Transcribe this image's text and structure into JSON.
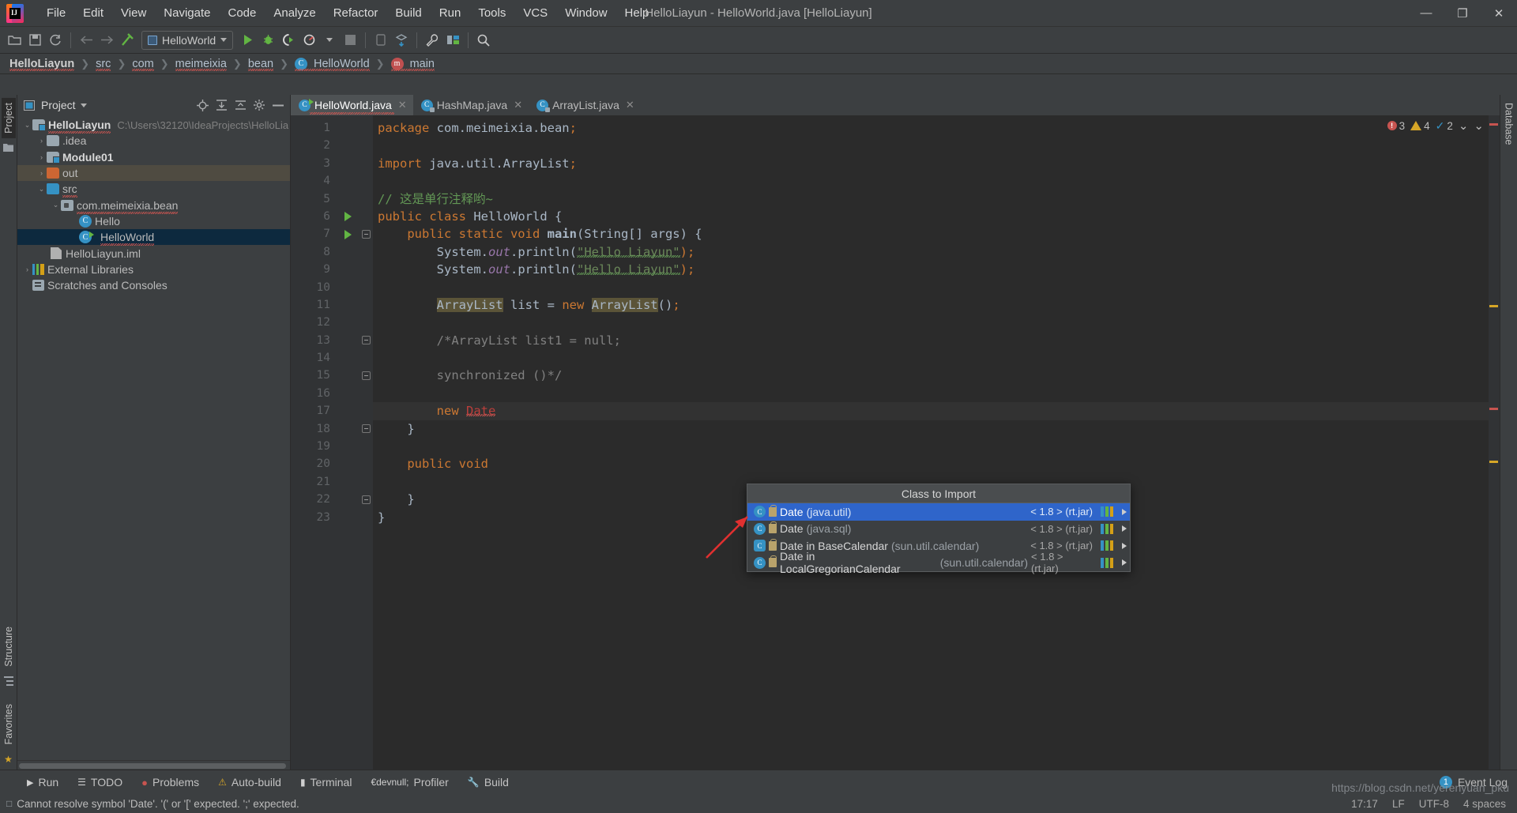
{
  "window": {
    "title": "HelloLiayun - HelloWorld.java [HelloLiayun]",
    "minimize": "—",
    "maximize": "❐",
    "close": "✕"
  },
  "menu": [
    {
      "label": "File"
    },
    {
      "label": "Edit"
    },
    {
      "label": "View"
    },
    {
      "label": "Navigate"
    },
    {
      "label": "Code"
    },
    {
      "label": "Analyze"
    },
    {
      "label": "Refactor"
    },
    {
      "label": "Build"
    },
    {
      "label": "Run"
    },
    {
      "label": "Tools"
    },
    {
      "label": "VCS"
    },
    {
      "label": "Window"
    },
    {
      "label": "Help"
    }
  ],
  "toolbar": {
    "run_config": "HelloWorld",
    "icons": [
      "open-folder-icon",
      "save-icon",
      "sync-icon",
      "back-arrow-icon",
      "forward-arrow-icon",
      "build-hammer-icon",
      "run-icon",
      "debug-icon",
      "run-coverage-icon",
      "profiler-icon",
      "stop-icon",
      "device-manager-icon",
      "sdk-manager-icon",
      "settings-wrench-icon",
      "project-structure-icon",
      "search-everywhere-icon"
    ]
  },
  "breadcrumb": [
    {
      "label": "HelloLiayun",
      "bold": true,
      "squiggle": true,
      "icon": ""
    },
    {
      "label": "src",
      "squiggle": true,
      "icon": ""
    },
    {
      "label": "com",
      "squiggle": true,
      "icon": ""
    },
    {
      "label": "meimeixia",
      "squiggle": true,
      "icon": ""
    },
    {
      "label": "bean",
      "squiggle": true,
      "icon": ""
    },
    {
      "label": "HelloWorld",
      "squiggle": true,
      "icon": "class-icon"
    },
    {
      "label": "main",
      "squiggle": true,
      "icon": "method-icon"
    }
  ],
  "left_rail": {
    "tabs": [
      "Project",
      "Structure",
      "Favorites"
    ],
    "icons": [
      "project-files-icon",
      "structure-icon",
      "favorites-star-icon"
    ]
  },
  "right_rail": {
    "tabs": [
      "Database"
    ]
  },
  "project_panel": {
    "title": "Project",
    "header_icons": [
      "locate-target-icon",
      "expand-all-icon",
      "collapse-all-icon",
      "gear-icon",
      "hide-icon"
    ],
    "tree": [
      {
        "depth": 0,
        "arrow": "⌄",
        "label": "HelloLiayun",
        "path": "C:\\Users\\32120\\IdeaProjects\\HelloLia",
        "icon": "folder-module",
        "bold": true,
        "squiggle": true
      },
      {
        "depth": 1,
        "arrow": "›",
        "label": ".idea",
        "icon": "folder-grey"
      },
      {
        "depth": 1,
        "arrow": "›",
        "label": "Module01",
        "icon": "folder-module",
        "bold": true
      },
      {
        "depth": 1,
        "arrow": "›",
        "label": "out",
        "icon": "folder-orange",
        "highlight": true
      },
      {
        "depth": 1,
        "arrow": "⌄",
        "label": "src",
        "icon": "folder-blue",
        "squiggle": true
      },
      {
        "depth": 2,
        "arrow": "⌄",
        "label": "com.meimeixia.bean",
        "icon": "package-icon",
        "squiggle": true
      },
      {
        "depth": 3,
        "arrow": "",
        "label": "Hello",
        "icon": "class-icon"
      },
      {
        "depth": 3,
        "arrow": "",
        "label": "HelloWorld",
        "icon": "class-run-icon",
        "selected": true,
        "squiggle": true
      },
      {
        "depth": 1,
        "arrow": "",
        "label": "HelloLiayun.iml",
        "icon": "iml-icon"
      },
      {
        "depth": 0,
        "arrow": "›",
        "label": "External Libraries",
        "icon": "library-icon"
      },
      {
        "depth": 0,
        "arrow": "",
        "label": "Scratches and Consoles",
        "icon": "scratches-icon"
      }
    ]
  },
  "editor_tabs": [
    {
      "label": "HelloWorld.java",
      "icon": "java-class-run-icon",
      "active": true,
      "close": "✕",
      "squiggle": true
    },
    {
      "label": "HashMap.java",
      "icon": "java-class-lock-icon",
      "active": false,
      "close": "✕"
    },
    {
      "label": "ArrayList.java",
      "icon": "java-class-lock-icon",
      "active": false,
      "close": "✕"
    }
  ],
  "code": {
    "lines": [
      {
        "n": "1",
        "text": "package com.meimeixia.bean;"
      },
      {
        "n": "2",
        "text": ""
      },
      {
        "n": "3",
        "text": "import java.util.ArrayList;"
      },
      {
        "n": "4",
        "text": ""
      },
      {
        "n": "5",
        "text": "// 这是单行注释哟~"
      },
      {
        "n": "6",
        "text": "public class HelloWorld {",
        "run": true
      },
      {
        "n": "7",
        "text": "    public static void main(String[] args) {",
        "run": true,
        "fold": "start"
      },
      {
        "n": "8",
        "text": "        System.out.println(\"Hello Liayun\");"
      },
      {
        "n": "9",
        "text": "        System.out.println(\"Hello Liayun\");"
      },
      {
        "n": "10",
        "text": ""
      },
      {
        "n": "11",
        "text": "        ArrayList list = new ArrayList();"
      },
      {
        "n": "12",
        "text": ""
      },
      {
        "n": "13",
        "text": "        /*ArrayList list1 = null;",
        "fold": "start"
      },
      {
        "n": "14",
        "text": ""
      },
      {
        "n": "15",
        "text": "        synchronized ()*/",
        "fold": "end"
      },
      {
        "n": "16",
        "text": ""
      },
      {
        "n": "17",
        "text": "        new Date",
        "current": true
      },
      {
        "n": "18",
        "text": "    }",
        "fold": "end"
      },
      {
        "n": "19",
        "text": ""
      },
      {
        "n": "20",
        "text": "    public void"
      },
      {
        "n": "21",
        "text": ""
      },
      {
        "n": "22",
        "text": "    }",
        "fold": "end"
      },
      {
        "n": "23",
        "text": "}"
      }
    ]
  },
  "inspections": {
    "errors": "3",
    "warnings": "4",
    "weak": "2",
    "chevron": "⌄",
    "more": "⌄"
  },
  "popup": {
    "title": "Class to Import",
    "rows": [
      {
        "name": "Date",
        "pkg": "(java.util)",
        "version": "< 1.8 > (rt.jar)",
        "icon": "class-icon",
        "selected": true,
        "arrow": "▶"
      },
      {
        "name": "Date",
        "pkg": "(java.sql)",
        "version": "< 1.8 > (rt.jar)",
        "icon": "class-icon",
        "selected": false,
        "arrow": "▶"
      },
      {
        "name": "Date in BaseCalendar",
        "pkg": "(sun.util.calendar)",
        "version": "< 1.8 > (rt.jar)",
        "icon": "class-inner-icon",
        "selected": false,
        "arrow": "▶"
      },
      {
        "name": "Date in LocalGregorianCalendar",
        "pkg": "(sun.util.calendar)",
        "version": "< 1.8 > (rt.jar)",
        "icon": "class-icon",
        "selected": false,
        "arrow": "▶"
      }
    ]
  },
  "bottom_bar": {
    "items": [
      {
        "label": "Run",
        "icon": "run-icon"
      },
      {
        "label": "TODO",
        "icon": "todo-icon"
      },
      {
        "label": "Problems",
        "icon": "problems-icon"
      },
      {
        "label": "Auto-build",
        "icon": "autobuild-icon"
      },
      {
        "label": "Terminal",
        "icon": "terminal-icon"
      },
      {
        "label": "Profiler",
        "icon": "profiler-icon"
      },
      {
        "label": "Build",
        "icon": "build-icon"
      }
    ],
    "event_log": {
      "label": "Event Log",
      "count": "1"
    }
  },
  "status_bar": {
    "message": "Cannot resolve symbol 'Date'. '(' or '[' expected. ';' expected.",
    "caret": "17:17",
    "line_sep": "LF",
    "encoding": "UTF-8",
    "indent": "4 spaces"
  },
  "watermark": "https://blog.csdn.net/yerenyuan_pku",
  "colors": {
    "accent_blue": "#3592c4",
    "selection_blue": "#2f65ca",
    "error_red": "#c75450",
    "warning_yellow": "#d6a627",
    "run_green": "#62b543",
    "editor_bg": "#2b2b2b",
    "panel_bg": "#3c3f41"
  }
}
